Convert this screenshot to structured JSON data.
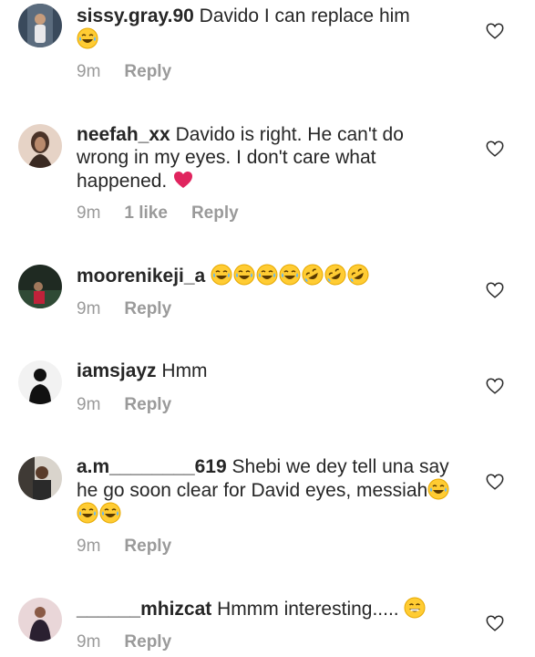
{
  "comments": [
    {
      "username": "sissy.gray.90",
      "text": " Davido I can replace him",
      "emojis": [
        "laughing-tears"
      ],
      "time": "9m",
      "likes": "",
      "reply": "Reply"
    },
    {
      "username": "neefah_xx",
      "text": " Davido is right. He can't do wrong in my eyes. I don't care what happened.",
      "emojis": [
        "red-heart"
      ],
      "time": "9m",
      "likes": "1 like",
      "reply": "Reply"
    },
    {
      "username": "moorenikeji_a",
      "text": " ",
      "emojis": [
        "laughing-tears",
        "laughing-tears",
        "laughing-tears",
        "laughing-tears",
        "rolling-laughing",
        "rolling-laughing",
        "rolling-laughing"
      ],
      "time": "9m",
      "likes": "",
      "reply": "Reply"
    },
    {
      "username": "iamsjayz",
      "text": " Hmm",
      "emojis": [],
      "time": "9m",
      "likes": "",
      "reply": "Reply"
    },
    {
      "username": "a.m________619",
      "text": " Shebi we dey tell una say he go soon clear for David eyes, messiah",
      "emojis": [
        "laughing-tears",
        "laughing-tears",
        "laughing-tears"
      ],
      "time": "9m",
      "likes": "",
      "reply": "Reply"
    },
    {
      "username": "______mhizcat",
      "text": " Hmmm interesting..... ",
      "emojis": [
        "grinning-face"
      ],
      "time": "9m",
      "likes": "",
      "reply": "Reply"
    }
  ],
  "colors": {
    "meta": "#9a9a9a",
    "text": "#262626",
    "heart_emoji": "#e0245e",
    "emoji_yellow": "#ffcc33"
  }
}
